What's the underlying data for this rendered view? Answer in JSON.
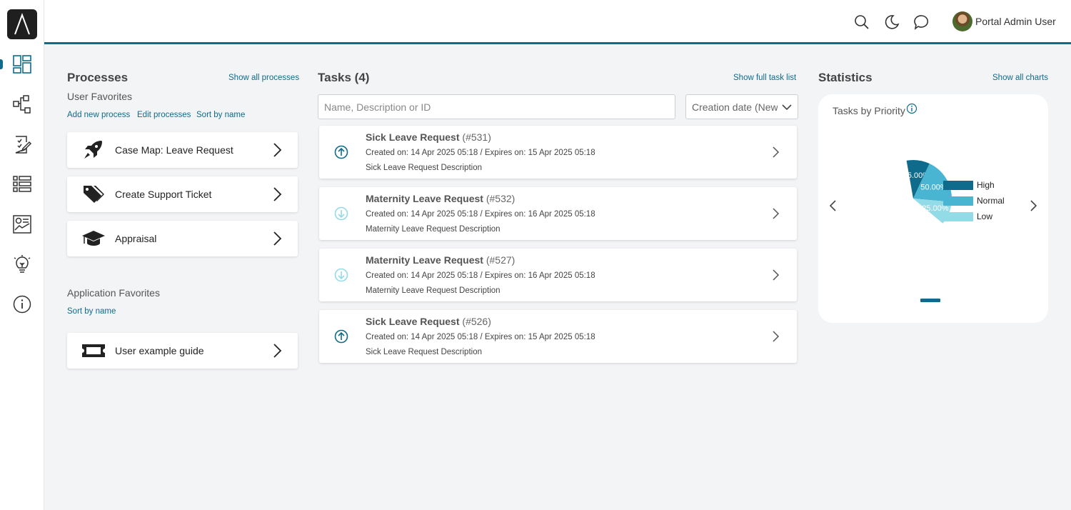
{
  "header": {
    "user_name": "Portal Admin User",
    "accent_color": "#0e6b8c"
  },
  "sidebar": {
    "items": [
      {
        "name": "dashboard-icon"
      },
      {
        "name": "processes-icon"
      },
      {
        "name": "tasks-icon"
      },
      {
        "name": "cases-icon"
      },
      {
        "name": "statistics-icon"
      },
      {
        "name": "idea-icon"
      },
      {
        "name": "about-icon"
      }
    ]
  },
  "processes": {
    "title": "Processes",
    "show_all": "Show all processes",
    "user_favorites": "User Favorites",
    "add_new": "Add new process",
    "edit": "Edit processes",
    "sort": "Sort by name",
    "items": [
      {
        "label": "Case Map: Leave Request",
        "icon": "rocket-icon"
      },
      {
        "label": "Create Support Ticket",
        "icon": "tags-icon"
      },
      {
        "label": "Appraisal",
        "icon": "graduation-cap-icon"
      }
    ],
    "app_favorites": "Application Favorites",
    "app_sort": "Sort by name",
    "app_items": [
      {
        "label": "User example guide",
        "icon": "ticket-icon"
      }
    ]
  },
  "tasks": {
    "title": "Tasks (4)",
    "show_full": "Show full task list",
    "search_placeholder": "Name, Description or ID",
    "sort_value": "Creation date (Newest first)",
    "items": [
      {
        "name": "Sick Leave Request",
        "id": "(#531)",
        "dates": "Created on: 14 Apr 2025 05:18 / Expires on: 15 Apr 2025 05:18",
        "desc": "Sick Leave Request Description",
        "priority": "high"
      },
      {
        "name": "Maternity Leave Request",
        "id": "(#532)",
        "dates": "Created on: 14 Apr 2025 05:18 / Expires on: 16 Apr 2025 05:18",
        "desc": "Maternity Leave Request Description",
        "priority": "low"
      },
      {
        "name": "Maternity Leave Request",
        "id": "(#527)",
        "dates": "Created on: 14 Apr 2025 05:18 / Expires on: 16 Apr 2025 05:18",
        "desc": "Maternity Leave Request Description",
        "priority": "low"
      },
      {
        "name": "Sick Leave Request",
        "id": "(#526)",
        "dates": "Created on: 14 Apr 2025 05:18 / Expires on: 15 Apr 2025 05:18",
        "desc": "Sick Leave Request Description",
        "priority": "high"
      }
    ]
  },
  "statistics": {
    "title": "Statistics",
    "show_all": "Show all charts",
    "chart_title": "Tasks by Priority"
  },
  "chart_data": {
    "type": "pie",
    "title": "Tasks by Priority",
    "categories": [
      "High",
      "Normal",
      "Low"
    ],
    "values": [
      25.0,
      50.0,
      25.0
    ],
    "value_labels": [
      "25.00%",
      "50.00%",
      "25.00%"
    ],
    "colors": [
      "#0e6b8c",
      "#4ab5d3",
      "#94dbe8"
    ],
    "legend_position": "right"
  }
}
